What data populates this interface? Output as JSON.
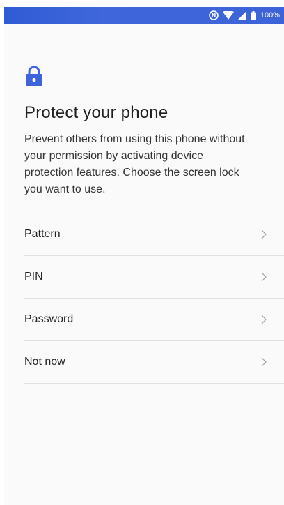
{
  "status_bar": {
    "battery_text": "100%",
    "icons": [
      "nfc-icon",
      "wifi-icon",
      "signal-icon",
      "battery-icon"
    ]
  },
  "header": {
    "icon": "lock-icon",
    "title": "Protect your phone",
    "description": "Prevent others from using this phone without your permission by activating device protection features. Choose the screen lock you want to use."
  },
  "options": [
    {
      "label": "Pattern"
    },
    {
      "label": "PIN"
    },
    {
      "label": "Password"
    },
    {
      "label": "Not now"
    }
  ],
  "colors": {
    "accent": "#3d63dd",
    "status_bar": "#3c63d8",
    "background": "#fafafa",
    "divider": "#e0e0e0"
  }
}
